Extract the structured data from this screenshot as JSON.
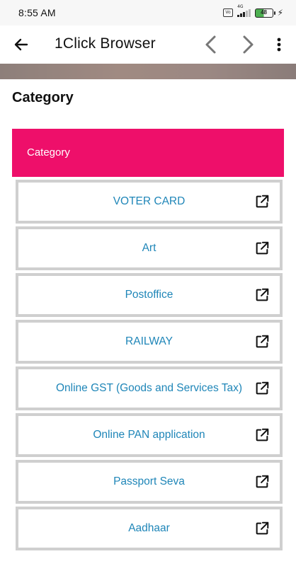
{
  "status_bar": {
    "time": "8:55 AM",
    "network_label": "4G",
    "battery_level": "48",
    "icons": [
      "volte-icon",
      "signal-icon",
      "battery-icon",
      "charging-icon"
    ]
  },
  "app_bar": {
    "title": "1Click Browser",
    "icons": [
      "back-arrow-icon",
      "chevron-left-icon",
      "chevron-right-icon",
      "more-vertical-icon"
    ]
  },
  "page": {
    "heading": "Category",
    "category_header": "Category"
  },
  "items": [
    {
      "label": "VOTER CARD"
    },
    {
      "label": "Art"
    },
    {
      "label": "Postoffice"
    },
    {
      "label": "RAILWAY"
    },
    {
      "label": "Online GST (Goods and Services Tax)"
    },
    {
      "label": "Online PAN application"
    },
    {
      "label": "Passport Seva"
    },
    {
      "label": "Aadhaar"
    }
  ],
  "colors": {
    "accent": "#ee0f6a",
    "link_text": "#1f86b8",
    "item_border": "#cfcfcf"
  }
}
